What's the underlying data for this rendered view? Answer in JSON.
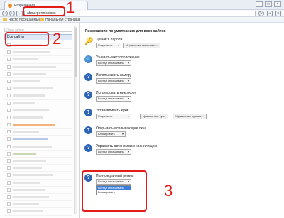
{
  "browser": {
    "tab_title": "Разрешения",
    "tab_prefix": "Fi",
    "address": "about:permissions",
    "window_buttons": [
      "–",
      "□",
      "×"
    ]
  },
  "bookmarks": [
    {
      "label": "Часто посещаемые",
      "icon": "folder-icon"
    },
    {
      "label": "Начальная страница",
      "icon": "folder-icon"
    }
  ],
  "left_panel": {
    "search_placeholder": "Поиск сайтов",
    "all_sites_label": "Все сайты",
    "site_rows": 24
  },
  "right_panel": {
    "header": "Разрешения по умолчанию для всех сайтов",
    "permissions": [
      {
        "title": "Хранить пароли",
        "icon": "key-icon",
        "buttons": [
          "Управление паролями..."
        ],
        "select": "Разрешить"
      },
      {
        "title": "Узнавать местоположение",
        "icon": "globe-icon",
        "select": "Всегда спрашивать"
      },
      {
        "title": "Использовать камеру",
        "icon": "question-icon",
        "select": "Всегда спрашивать"
      },
      {
        "title": "Использовать микрофон",
        "icon": "question-icon",
        "select": "Всегда спрашивать"
      },
      {
        "title": "Устанавливать куки",
        "icon": "question-icon",
        "select": "Разрешить",
        "buttons": [
          "Удалить все куки",
          "Управление куками..."
        ]
      },
      {
        "title": "Открывать всплывающие окна",
        "icon": "question-icon",
        "select": "Блокировать"
      },
      {
        "title": "Управлять автономным хранилищем",
        "icon": "question-icon",
        "select": "Всегда спрашивать"
      },
      {
        "title": "Полноэкранный режим",
        "icon": "question-icon",
        "select": "Всегда спрашивать",
        "options": [
          "Всегда спрашивать",
          "Блокировать"
        ]
      }
    ]
  },
  "annotations": {
    "one": "1",
    "two": "2",
    "three": "3",
    "color": "#e21b1b"
  }
}
